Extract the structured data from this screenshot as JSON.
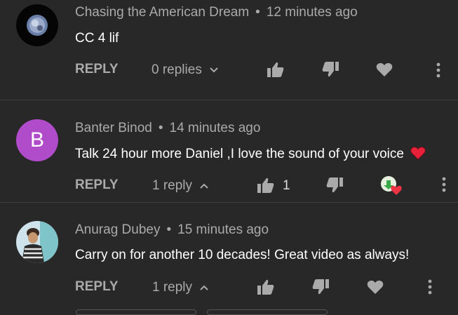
{
  "comments": [
    {
      "author": "Chasing the American Dream",
      "time": "12 minutes ago",
      "text": "CC 4 lif",
      "reply_label": "REPLY",
      "replies_label": "0 replies",
      "like_count": "",
      "avatar_letter": ""
    },
    {
      "author": "Banter Binod",
      "time": "14 minutes ago",
      "text": "Talk 24 hour more Daniel ,I love the sound of your voice",
      "reply_label": "REPLY",
      "replies_label": "1 reply",
      "like_count": "1",
      "avatar_letter": "B"
    },
    {
      "author": "Anurag Dubey",
      "time": "15 minutes ago",
      "text": "Carry on for another 10 decades! Great video as always!",
      "reply_label": "REPLY",
      "replies_label": "1 reply",
      "like_count": "",
      "avatar_letter": ""
    }
  ],
  "separator": "•",
  "colors": {
    "background": "#282828",
    "meta_text": "#aaaaaa",
    "body_text": "#ffffff",
    "avatar_b": "#b04bc9",
    "heart_emoji": "#e8213a"
  },
  "icons": [
    "thumbs-up-icon",
    "thumbs-down-icon",
    "heart-icon",
    "more-vert-icon",
    "chevron-down-icon",
    "chevron-up-icon",
    "creator-heart-icon"
  ]
}
